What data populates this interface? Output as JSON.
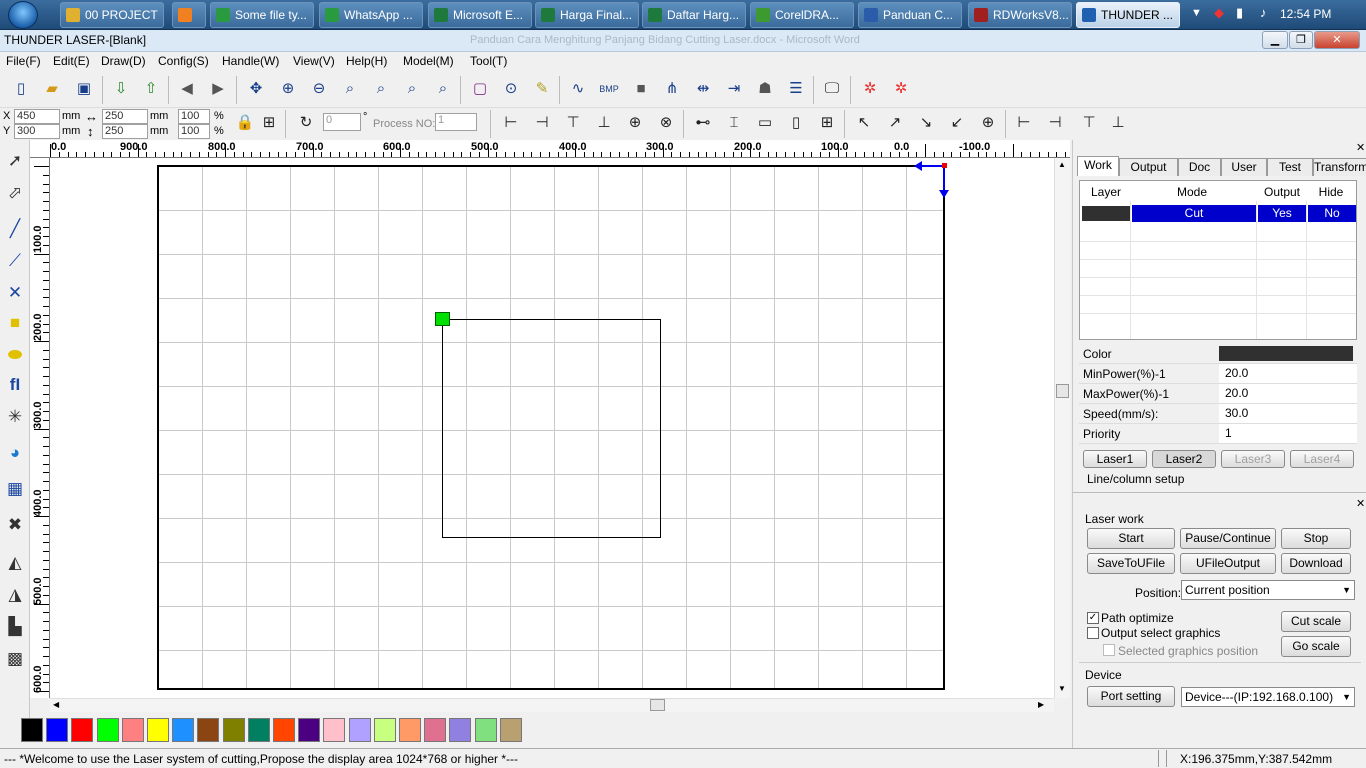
{
  "taskbar": {
    "items": [
      {
        "label": "00 PROJECT",
        "icon": "folder-icon",
        "color": "#e0b030"
      },
      {
        "label": "",
        "icon": "media-player-icon",
        "color": "#f08020"
      },
      {
        "label": "Some file ty...",
        "icon": "chrome-icon",
        "color": "#2a9a40"
      },
      {
        "label": "WhatsApp ...",
        "icon": "chrome-icon",
        "color": "#2a9a40"
      },
      {
        "label": "Microsoft E...",
        "icon": "excel-icon",
        "color": "#1e7a3c"
      },
      {
        "label": "Harga Final...",
        "icon": "excel-icon",
        "color": "#1e7a3c"
      },
      {
        "label": "Daftar Harg...",
        "icon": "excel-icon",
        "color": "#1e7a3c"
      },
      {
        "label": "CorelDRA...",
        "icon": "coreldraw-icon",
        "color": "#3c9a30"
      },
      {
        "label": "Panduan C...",
        "icon": "word-icon",
        "color": "#2a5caa"
      },
      {
        "label": "RDWorksV8...",
        "icon": "rdworks-icon",
        "color": "#a02020"
      },
      {
        "label": "THUNDER ...",
        "icon": "thunder-laser-icon",
        "color": "#2060b0"
      }
    ],
    "clock": "12:54 PM"
  },
  "window": {
    "title": "THUNDER LASER-[Blank]",
    "ghost_title": "Panduan Cara Menghitung Panjang Bidang Cutting Laser.docx - Microsoft Word"
  },
  "menu": [
    "File(F)",
    "Edit(E)",
    "Draw(D)",
    "Config(S)",
    "Handle(W)",
    "View(V)",
    "Help(H)",
    "Model(M)",
    "Tool(T)"
  ],
  "coords": {
    "x_label": "X",
    "y_label": "Y",
    "x": "450",
    "y": "300",
    "unit": "mm",
    "width": "250",
    "height": "250",
    "scale_x": "100",
    "scale_y": "100",
    "pct": "%",
    "angle": "0",
    "deg": "°",
    "process_label": "Process NO:",
    "process_no": "1"
  },
  "rulers": {
    "h": [
      "0.0",
      "900.0",
      "800.0",
      "700.0",
      "600.0",
      "500.0",
      "400.0",
      "300.0",
      "200.0",
      "100.0",
      "0.0",
      "-100.0"
    ],
    "v": [
      "100.0",
      "200.0",
      "300.0",
      "400.0",
      "500.0",
      "600.0"
    ]
  },
  "panel": {
    "tabs": [
      "Work",
      "Output",
      "Doc",
      "User",
      "Test",
      "Transform"
    ],
    "layer_headers": [
      "Layer",
      "Mode",
      "Output",
      "Hide"
    ],
    "layer_row": {
      "color": "#303030",
      "mode": "Cut",
      "output": "Yes",
      "hide": "No"
    },
    "props": [
      {
        "key": "Color",
        "value": ""
      },
      {
        "key": "MinPower(%)-1",
        "value": "20.0"
      },
      {
        "key": "MaxPower(%)-1",
        "value": "20.0"
      },
      {
        "key": "Speed(mm/s):",
        "value": "30.0"
      },
      {
        "key": "Priority",
        "value": "1"
      }
    ],
    "lasers": [
      "Laser1",
      "Laser2",
      "Laser3",
      "Laser4"
    ],
    "line_col": "Line/column setup",
    "laser_work": "Laser work",
    "buttons": [
      "Start",
      "Pause/Continue",
      "Stop",
      "SaveToUFile",
      "UFileOutput",
      "Download"
    ],
    "position_label": "Position:",
    "position_value": "Current position",
    "path_optimize": "Path optimize",
    "output_select": "Output select graphics",
    "selected_pos": "Selected graphics position",
    "cut_scale": "Cut scale",
    "go_scale": "Go scale",
    "device_label": "Device",
    "port_setting": "Port setting",
    "device_value": "Device---(IP:192.168.0.100)"
  },
  "palette": [
    "#000000",
    "#0000ff",
    "#ff0000",
    "#00ff00",
    "#ff8080",
    "#ffff00",
    "#1e90ff",
    "#8b4513",
    "#808000",
    "#008060",
    "#ff4500",
    "#4b0082",
    "#ffc0cb",
    "#b0a0ff",
    "#c8ff80",
    "#ff9966",
    "#e07090",
    "#9080e0",
    "#80e080",
    "#b8a070"
  ],
  "status": {
    "message": "--- *Welcome to use the Laser system of cutting,Propose the display area 1024*768 or higher *---",
    "coords": "X:196.375mm,Y:387.542mm"
  }
}
